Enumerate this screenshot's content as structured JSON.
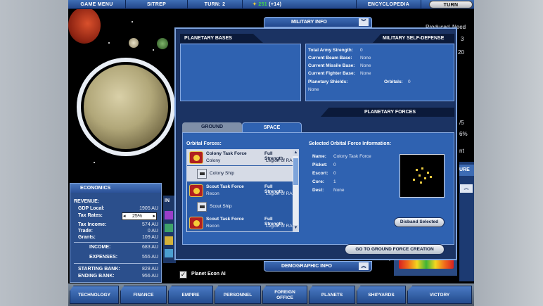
{
  "topbar": {
    "game_menu": "GAME MENU",
    "sitrep": "SITREP",
    "turn_label": "TURN: 2",
    "resource_value": "251",
    "resource_delta": "(+14)",
    "encyclopedia": "ENCYCLOPEDIA",
    "turn_button": "TURN"
  },
  "right_column": {
    "produced": "Produced",
    "need": "Need",
    "r1": "3",
    "r2": "20",
    "r3": "/5",
    "r4": "6%",
    "r5": "nt",
    "r6": "URE"
  },
  "military_info_tab": "MILITARY INFO",
  "planetary_bases": {
    "title": "PLANETARY BASES"
  },
  "military_self_defense": {
    "title": "MILITARY SELF-DEFENSE",
    "total_army_strength_label": "Total Army Strength:",
    "total_army_strength": "0",
    "beam_base_label": "Current Beam Base:",
    "beam_base": "None",
    "missile_base_label": "Current Missile Base:",
    "missile_base": "None",
    "fighter_base_label": "Current Fighter Base:",
    "fighter_base": "None",
    "shields_label": "Planetary Shields:",
    "shields": "None",
    "orbitals_label": "Orbitals:",
    "orbitals": "0"
  },
  "planetary_forces": {
    "title": "PLANETARY FORCES",
    "tab_ground": "GROUND",
    "tab_space": "SPACE",
    "orbital_forces_label": "Orbital Forces:",
    "selected_info_label": "Selected Orbital Force Information:",
    "list": [
      {
        "name": "Colony Task Force",
        "strength": "Full Strength",
        "type": "Colony",
        "owner": "Legion of RA",
        "ship": "Colony Ship"
      },
      {
        "name": "Scout Task Force",
        "strength": "Full Strength",
        "type": "Recon",
        "owner": "Legion of RA",
        "ship": "Scout Ship"
      },
      {
        "name": "Scout Task Force",
        "strength": "Full Strength",
        "type": "Recon",
        "owner": "Legion of RA"
      }
    ],
    "info": {
      "name_label": "Name:",
      "name": "Colony Task Force",
      "picket_label": "Picket:",
      "picket": "0",
      "escort_label": "Escort:",
      "escort": "0",
      "core_label": "Core:",
      "core": "1",
      "dest_label": "Dest:",
      "dest": "None"
    },
    "disband_button": "Disband Selected",
    "ground_creation_button": "GO TO GROUND FORCE CREATION"
  },
  "demographic_tab": "DEMOGRAPHIC INFO",
  "economics": {
    "title": "ECONOMICS",
    "revenue_label": "REVENUE:",
    "gdp_label": "GDP Local:",
    "gdp": "1905 AU",
    "tax_rates_label": "Tax Rates:",
    "tax_rate": "25%",
    "tax_income_label": "Tax Income:",
    "tax_income": "574 AU",
    "trade_label": "Trade:",
    "trade": "0 AU",
    "grants_label": "Grants:",
    "grants": "109 AU",
    "income_label": "INCOME:",
    "income": "683 AU",
    "expenses_label": "EXPENSES:",
    "expenses": "555 AU",
    "starting_bank_label": "STARTING BANK:",
    "starting_bank": "828 AU",
    "ending_bank_label": "ENDING BANK:",
    "ending_bank": "956 AU"
  },
  "mid_strip_label": "IN",
  "econ_ai": {
    "checked": "✓",
    "label": "Planet Econ AI"
  },
  "nav": {
    "technology": "TECHNOLOGY",
    "finance": "FINANCE",
    "empire": "EMPIRE",
    "personnel": "PERSONNEL",
    "foreign_1": "FOREIGN",
    "foreign_2": "OFFICE",
    "planets": "PLANETS",
    "shipyards": "SHIPYARDS",
    "victory": "VICTORY"
  }
}
